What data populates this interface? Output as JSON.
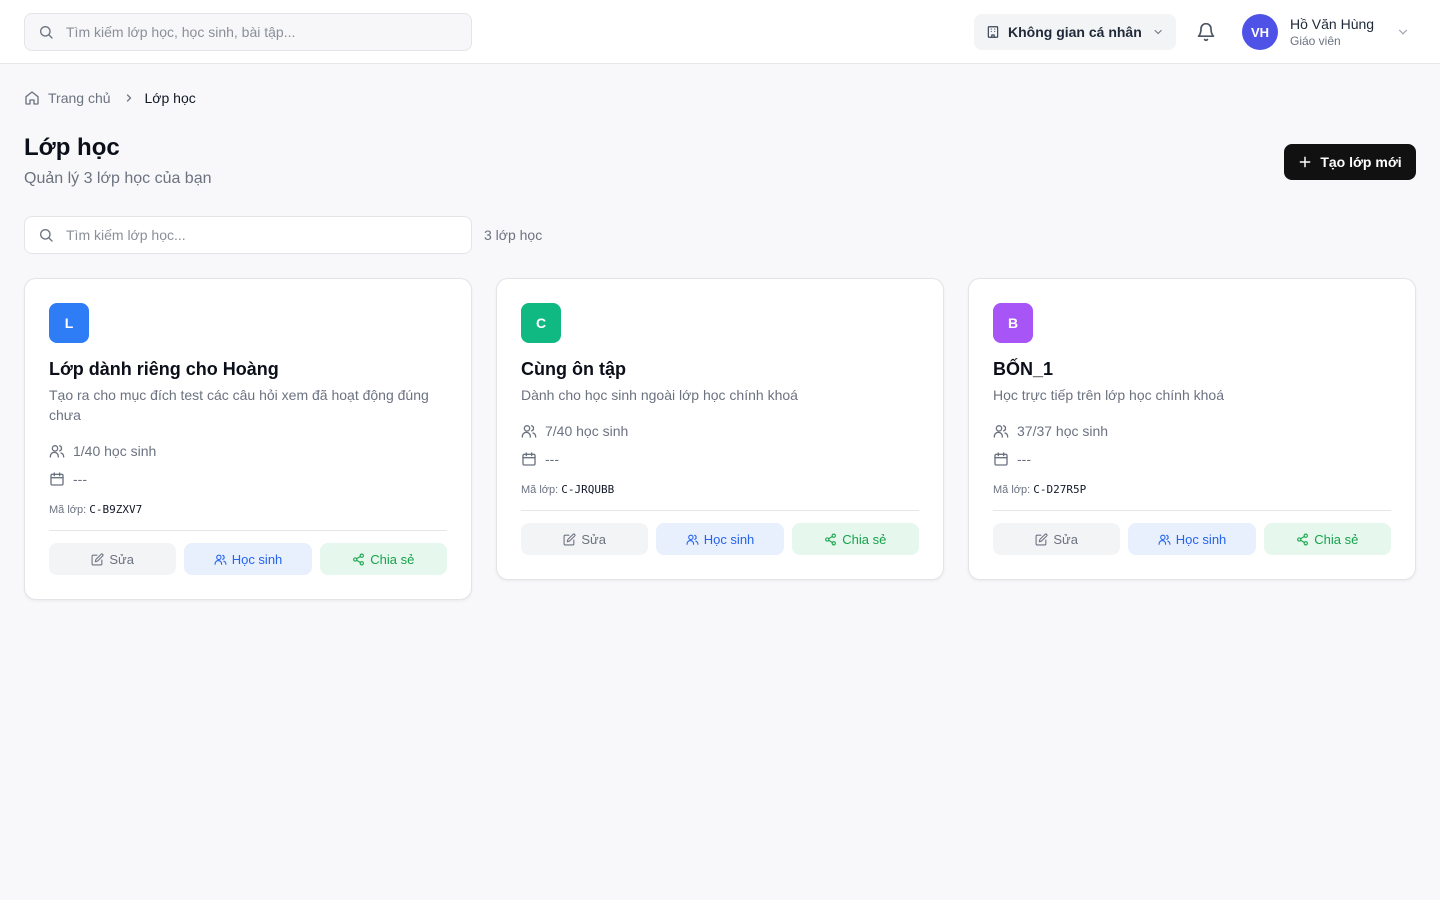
{
  "header": {
    "search_placeholder": "Tìm kiếm lớp học, học sinh, bài tập...",
    "workspace_label": "Không gian cá nhân",
    "user": {
      "initials": "VH",
      "name": "Hồ Văn Hùng",
      "role": "Giáo viên"
    }
  },
  "breadcrumb": {
    "home": "Trang chủ",
    "current": "Lớp học"
  },
  "page": {
    "title": "Lớp học",
    "subtitle": "Quản lý 3 lớp học của bạn",
    "create_button": "Tạo lớp mới",
    "search_placeholder": "Tìm kiếm lớp học...",
    "count_label": "3 lớp học"
  },
  "labels": {
    "code_prefix": "Mã lớp:",
    "edit": "Sửa",
    "students": "Học sinh",
    "share": "Chia sẻ"
  },
  "classes": [
    {
      "initial": "L",
      "color": "#2f7df6",
      "name": "Lớp dành riêng cho Hoàng",
      "description": "Tạo ra cho mục đích test các câu hỏi xem đã hoạt động đúng chưa",
      "students": "1/40 học sinh",
      "schedule": "---",
      "code": "C-B9ZXV7"
    },
    {
      "initial": "C",
      "color": "#10b981",
      "name": "Cùng ôn tập",
      "description": "Dành cho học sinh ngoài lớp học chính khoá",
      "students": "7/40 học sinh",
      "schedule": "---",
      "code": "C-JRQUBB"
    },
    {
      "initial": "B",
      "color": "#a855f7",
      "name": "BỐN_1",
      "description": "Học trực tiếp trên lớp học chính khoá",
      "students": "37/37 học sinh",
      "schedule": "---",
      "code": "C-D27R5P"
    }
  ],
  "colors": {
    "primary_button": "#111111",
    "avatar": "#4f52e6",
    "students_button": "#2563eb",
    "share_button": "#16a34a"
  }
}
